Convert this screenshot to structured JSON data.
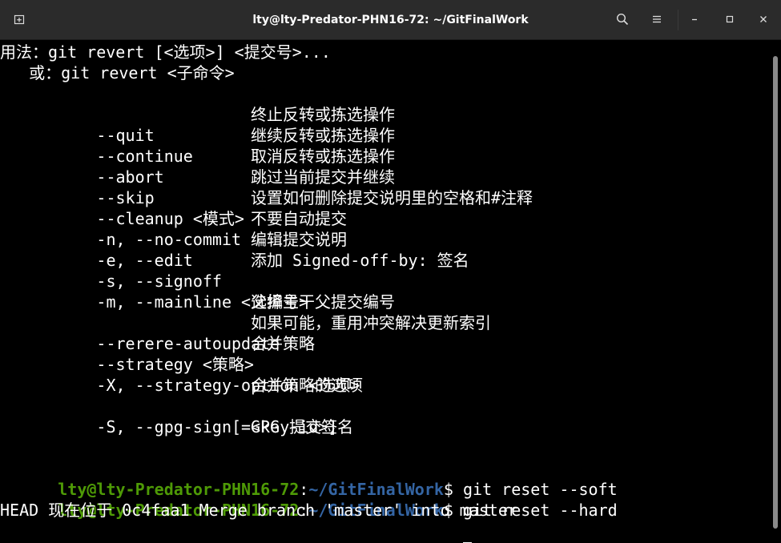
{
  "window": {
    "title": "lty@lty-Predator-PHN16-72: ~/GitFinalWork"
  },
  "titlebar": {
    "icons": [
      "new-tab-icon",
      "search-icon",
      "hamburger-menu-icon",
      "minimize-icon",
      "maximize-icon",
      "close-icon"
    ]
  },
  "terminal": {
    "usage_line1": "用法：git revert [<选项>] <提交号>...",
    "usage_line2": "   或：git revert <子命令>",
    "options": [
      {
        "flag": "    --quit",
        "desc": "终止反转或拣选操作"
      },
      {
        "flag": "    --continue",
        "desc": "继续反转或拣选操作"
      },
      {
        "flag": "    --abort",
        "desc": "取消反转或拣选操作"
      },
      {
        "flag": "    --skip",
        "desc": "跳过当前提交并继续"
      },
      {
        "flag": "    --cleanup <模式>",
        "desc": "设置如何删除提交说明里的空格和#注释"
      },
      {
        "flag": "    -n, --no-commit",
        "desc": "不要自动提交"
      },
      {
        "flag": "    -e, --edit",
        "desc": "编辑提交说明"
      },
      {
        "flag": "    -s, --signoff",
        "desc": "添加 Signed-off-by: 签名"
      },
      {
        "flag": "    -m, --mainline <父编号>",
        "desc": ""
      },
      {
        "flag": "",
        "desc": "选择主干父提交编号"
      },
      {
        "flag": "    --rerere-autoupdate",
        "desc": "如果可能，重用冲突解决更新索引"
      },
      {
        "flag": "    --strategy <策略>",
        "desc": "合并策略"
      },
      {
        "flag": "    -X, --strategy-option <选项>",
        "desc": ""
      },
      {
        "flag": "",
        "desc": "合并策略的选项"
      },
      {
        "flag": "    -S, --gpg-sign[=<key-id>]",
        "desc": ""
      },
      {
        "flag": "",
        "desc": "GPG 提交签名"
      }
    ],
    "prompt": {
      "user_host": "lty@lty-Predator-PHN16-72",
      "colon": ":",
      "path": "~/GitFinalWork",
      "dollar": "$"
    },
    "commands": [
      " git reset --soft",
      " git reset --hard"
    ],
    "reset_output": "HEAD 现在位于 0c4faa1 Merge branch 'master' into master"
  },
  "colors": {
    "background": "#000000",
    "titlebar": "#2b2b2b",
    "prompt_user": "#4e9a06",
    "prompt_path": "#3465a4",
    "text": "#ffffff"
  }
}
